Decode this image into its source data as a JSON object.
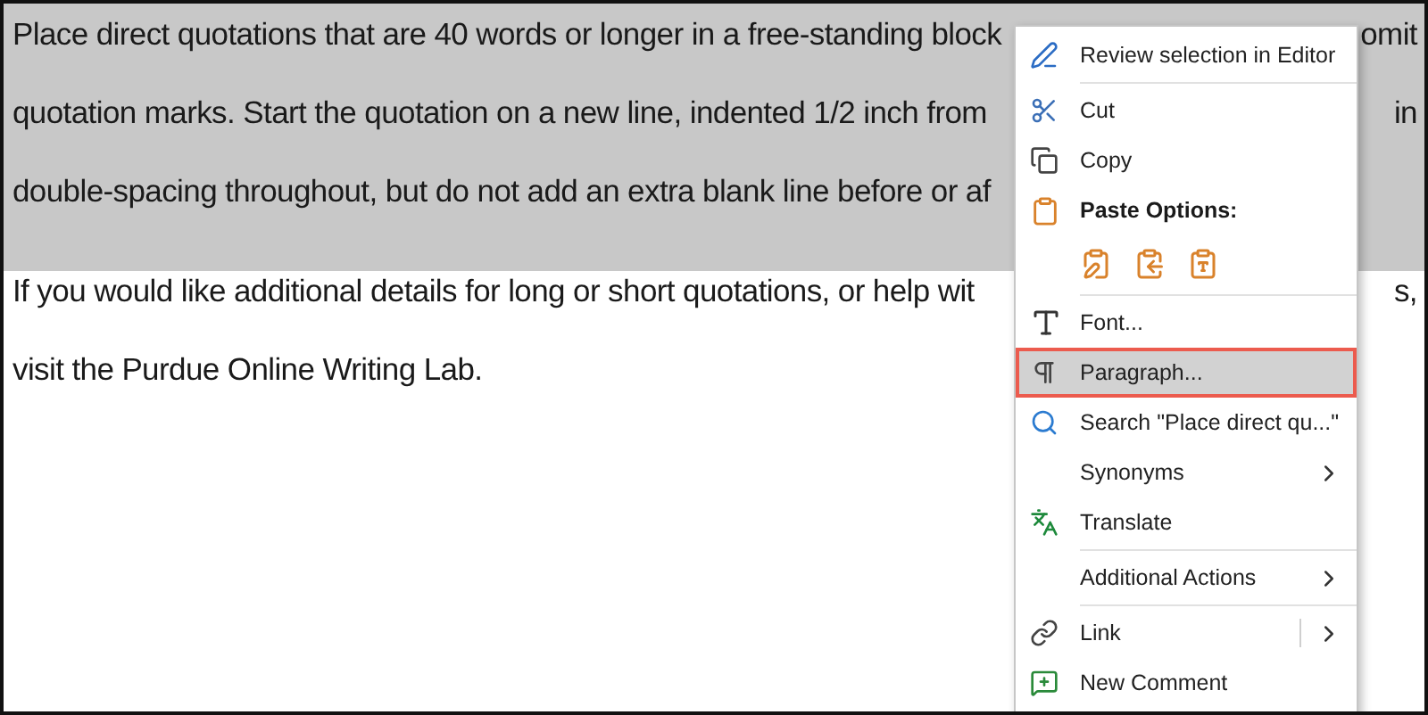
{
  "document": {
    "paragraphs": [
      {
        "selected": true,
        "lines": [
          {
            "text": "Place direct quotations that are 40 words or longer in a free-standing block",
            "tail": "omit"
          },
          {
            "text": "quotation marks. Start the quotation on a new line, indented 1/2 inch from",
            "tail": "in"
          },
          {
            "text": "double-spacing throughout, but do not add an extra blank line before or af"
          }
        ]
      },
      {
        "selected": false,
        "lines": [
          {
            "text": "If you would like additional details for long or short quotations, or help wit",
            "tail": "s,"
          },
          {
            "text": "visit the Purdue Online Writing Lab."
          }
        ]
      }
    ]
  },
  "context_menu": {
    "items": [
      {
        "kind": "item",
        "label": "Review selection in Editor",
        "selected": false,
        "submenu": false
      },
      {
        "kind": "separator"
      },
      {
        "kind": "item",
        "label": "Cut",
        "selected": false,
        "submenu": false
      },
      {
        "kind": "item",
        "label": "Copy",
        "selected": false,
        "submenu": false
      },
      {
        "kind": "header",
        "label": "Paste Options:"
      },
      {
        "kind": "paste_options"
      },
      {
        "kind": "separator"
      },
      {
        "kind": "item",
        "label": "Font...",
        "selected": false,
        "submenu": false
      },
      {
        "kind": "item",
        "label": "Paragraph...",
        "selected": true,
        "submenu": false
      },
      {
        "kind": "item",
        "label": "Search \"Place direct qu...\"",
        "selected": false,
        "submenu": false
      },
      {
        "kind": "item",
        "label": "Synonyms",
        "selected": false,
        "submenu": true
      },
      {
        "kind": "item",
        "label": "Translate",
        "selected": false,
        "submenu": false
      },
      {
        "kind": "separator"
      },
      {
        "kind": "item",
        "label": "Additional Actions",
        "selected": false,
        "submenu": true
      },
      {
        "kind": "separator"
      },
      {
        "kind": "split_item",
        "label": "Link",
        "selected": false,
        "submenu": true
      },
      {
        "kind": "item",
        "label": "New Comment",
        "selected": false,
        "submenu": false
      }
    ]
  }
}
